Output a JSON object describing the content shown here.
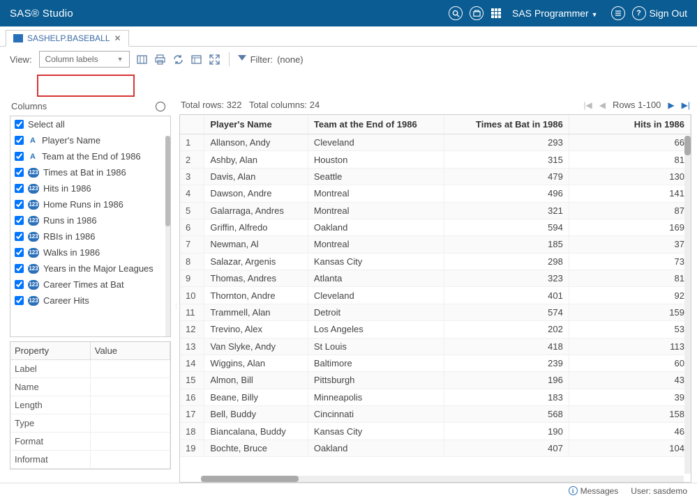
{
  "brand": "SAS® Studio",
  "user_label": "SAS Programmer",
  "signout": "Sign Out",
  "tab": {
    "title": "SASHELP.BASEBALL"
  },
  "toolbar": {
    "view_label": "View:",
    "view_select": "Column labels",
    "filter_label": "Filter:",
    "filter_value": "(none)"
  },
  "columns_panel": {
    "title": "Columns",
    "select_all": "Select all",
    "items": [
      {
        "label": "Player's Name",
        "type": "char"
      },
      {
        "label": "Team at the End of 1986",
        "type": "char"
      },
      {
        "label": "Times at Bat in 1986",
        "type": "num"
      },
      {
        "label": "Hits in 1986",
        "type": "num"
      },
      {
        "label": "Home Runs in 1986",
        "type": "num"
      },
      {
        "label": "Runs in 1986",
        "type": "num"
      },
      {
        "label": "RBIs in 1986",
        "type": "num"
      },
      {
        "label": "Walks in 1986",
        "type": "num"
      },
      {
        "label": "Years in the Major Leagues",
        "type": "num"
      },
      {
        "label": "Career Times at Bat",
        "type": "num"
      },
      {
        "label": "Career Hits",
        "type": "num"
      }
    ]
  },
  "properties": {
    "headers": {
      "property": "Property",
      "value": "Value"
    },
    "rows": [
      {
        "k": "Label",
        "v": ""
      },
      {
        "k": "Name",
        "v": ""
      },
      {
        "k": "Length",
        "v": ""
      },
      {
        "k": "Type",
        "v": ""
      },
      {
        "k": "Format",
        "v": ""
      },
      {
        "k": "Informat",
        "v": ""
      }
    ]
  },
  "grid": {
    "total_rows_label": "Total rows: 322",
    "total_cols_label": "Total columns: 24",
    "rows_range": "Rows 1-100",
    "headers": [
      "",
      "Player's Name",
      "Team at the End of 1986",
      "Times at Bat in 1986",
      "Hits in 1986"
    ],
    "rows": [
      {
        "i": 1,
        "c": [
          "Allanson, Andy",
          "Cleveland",
          "293",
          "66"
        ]
      },
      {
        "i": 2,
        "c": [
          "Ashby, Alan",
          "Houston",
          "315",
          "81"
        ]
      },
      {
        "i": 3,
        "c": [
          "Davis, Alan",
          "Seattle",
          "479",
          "130"
        ]
      },
      {
        "i": 4,
        "c": [
          "Dawson, Andre",
          "Montreal",
          "496",
          "141"
        ]
      },
      {
        "i": 5,
        "c": [
          "Galarraga, Andres",
          "Montreal",
          "321",
          "87"
        ]
      },
      {
        "i": 6,
        "c": [
          "Griffin, Alfredo",
          "Oakland",
          "594",
          "169"
        ]
      },
      {
        "i": 7,
        "c": [
          "Newman, Al",
          "Montreal",
          "185",
          "37"
        ]
      },
      {
        "i": 8,
        "c": [
          "Salazar, Argenis",
          "Kansas City",
          "298",
          "73"
        ]
      },
      {
        "i": 9,
        "c": [
          "Thomas, Andres",
          "Atlanta",
          "323",
          "81"
        ]
      },
      {
        "i": 10,
        "c": [
          "Thornton, Andre",
          "Cleveland",
          "401",
          "92"
        ]
      },
      {
        "i": 11,
        "c": [
          "Trammell, Alan",
          "Detroit",
          "574",
          "159"
        ]
      },
      {
        "i": 12,
        "c": [
          "Trevino, Alex",
          "Los Angeles",
          "202",
          "53"
        ]
      },
      {
        "i": 13,
        "c": [
          "Van Slyke, Andy",
          "St Louis",
          "418",
          "113"
        ]
      },
      {
        "i": 14,
        "c": [
          "Wiggins, Alan",
          "Baltimore",
          "239",
          "60"
        ]
      },
      {
        "i": 15,
        "c": [
          "Almon, Bill",
          "Pittsburgh",
          "196",
          "43"
        ]
      },
      {
        "i": 16,
        "c": [
          "Beane, Billy",
          "Minneapolis",
          "183",
          "39"
        ]
      },
      {
        "i": 17,
        "c": [
          "Bell, Buddy",
          "Cincinnati",
          "568",
          "158"
        ]
      },
      {
        "i": 18,
        "c": [
          "Biancalana, Buddy",
          "Kansas City",
          "190",
          "46"
        ]
      },
      {
        "i": 19,
        "c": [
          "Bochte, Bruce",
          "Oakland",
          "407",
          "104"
        ]
      }
    ]
  },
  "status": {
    "messages": "Messages",
    "user": "User: sasdemo"
  }
}
